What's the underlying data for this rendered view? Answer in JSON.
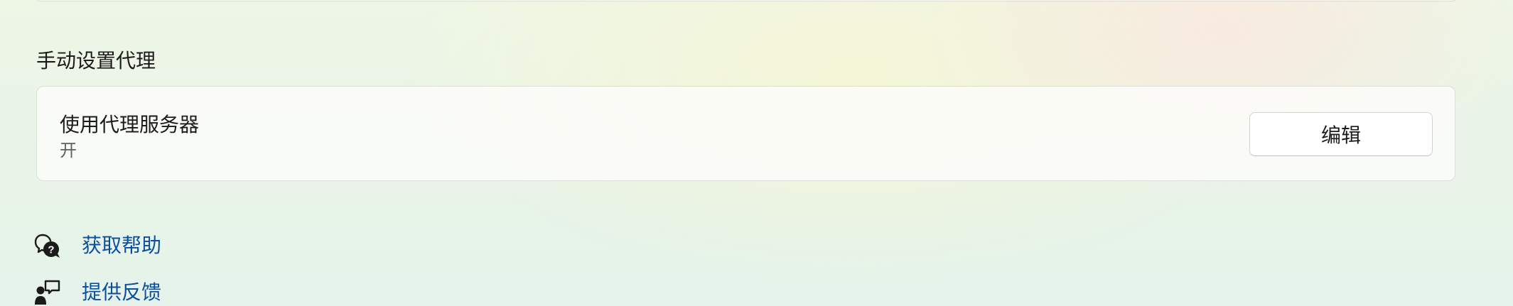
{
  "manual_proxy": {
    "section_title": "手动设置代理",
    "use_proxy": {
      "title": "使用代理服务器",
      "status": "开",
      "edit_button_label": "编辑"
    }
  },
  "links": {
    "get_help": {
      "label": "获取帮助",
      "icon": "help-chat-icon"
    },
    "give_feedback": {
      "label": "提供反馈",
      "icon": "feedback-icon"
    }
  }
}
